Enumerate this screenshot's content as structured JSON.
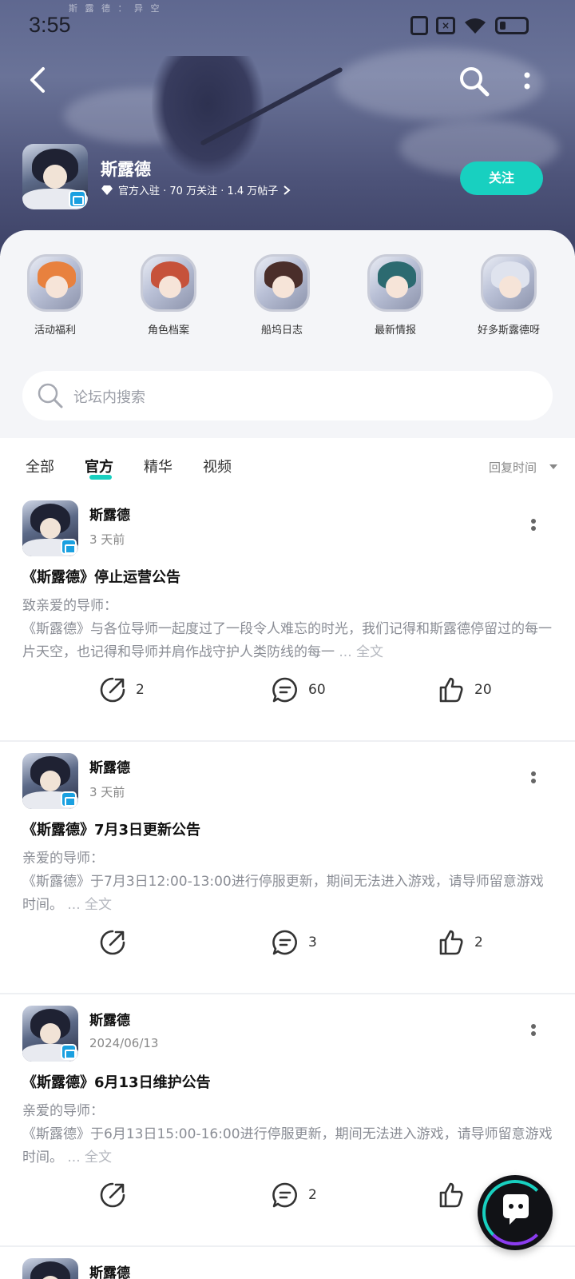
{
  "status_bar": {
    "time": "3:55"
  },
  "header": {
    "caption": "斯 露 德 ： 异 空",
    "forum_name": "斯露德",
    "meta": "官方入驻 · 70 万关注 · 1.4 万帖子",
    "follow_label": "关注"
  },
  "quick_links": [
    {
      "label": "活动福利"
    },
    {
      "label": "角色档案"
    },
    {
      "label": "船坞日志"
    },
    {
      "label": "最新情报"
    },
    {
      "label": "好多斯露德呀"
    }
  ],
  "search": {
    "placeholder": "论坛内搜索"
  },
  "tabs": [
    {
      "label": "全部"
    },
    {
      "label": "官方"
    },
    {
      "label": "精华"
    },
    {
      "label": "视频"
    }
  ],
  "active_tab": "官方",
  "sort": {
    "label": "回复时间"
  },
  "posts": [
    {
      "author": "斯露德",
      "time": "3 天前",
      "title": "《斯露德》停止运营公告",
      "body_line1": "致亲爱的导师：",
      "body_rest": "《斯露德》与各位导师一起度过了一段令人难忘的时光，我们记得和斯露德停留过的每一片天空，也记得和导师并肩作战守护人类防线的每一",
      "more_label": " ... 全文",
      "shares": "2",
      "comments": "60",
      "likes": "20"
    },
    {
      "author": "斯露德",
      "time": "3 天前",
      "title": "《斯露德》7月3日更新公告",
      "body_line1": "亲爱的导师：",
      "body_rest": "《斯露德》于7月3日12:00-13:00进行停服更新，期间无法进入游戏，请导师留意游戏时间。",
      "more_label": " ... 全文",
      "shares": "",
      "comments": "3",
      "likes": "2"
    },
    {
      "author": "斯露德",
      "time": "2024/06/13",
      "title": "《斯露德》6月13日维护公告",
      "body_line1": "亲爱的导师：",
      "body_rest": "《斯露德》于6月13日15:00-16:00进行停服更新，期间无法进入游戏，请导师留意游戏时间。",
      "more_label": " ... 全文",
      "shares": "",
      "comments": "2",
      "likes": ""
    },
    {
      "author": "斯露德"
    }
  ],
  "colors": {
    "accent": "#18d0c0",
    "hero": "#5f6890",
    "panel": "#f4f5f8"
  }
}
